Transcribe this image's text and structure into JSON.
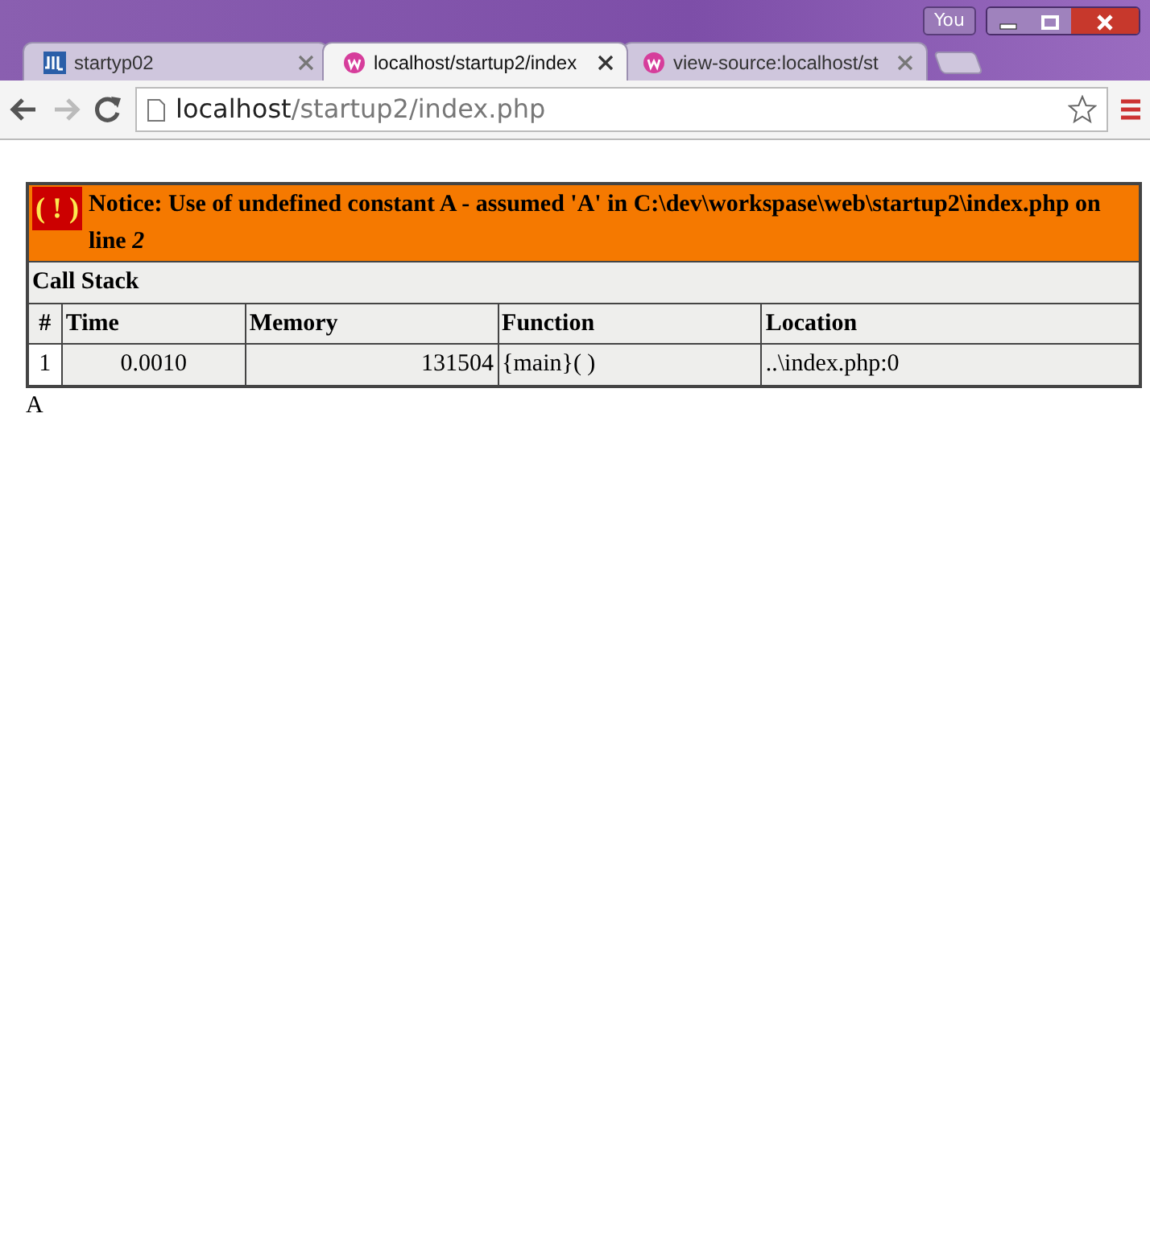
{
  "window": {
    "profile_button": "You"
  },
  "tabs": [
    {
      "label": "startyp02",
      "selected": false
    },
    {
      "label": "localhost/startup2/index",
      "selected": true
    },
    {
      "label": "view-source:localhost/st",
      "selected": false
    }
  ],
  "address_bar": {
    "host": "localhost",
    "path": "/startup2/index.php"
  },
  "error": {
    "badge": "( ! )",
    "message": "Notice: Use of undefined constant A - assumed 'A' in C:\\dev\\workspase\\web\\startup2\\index.php on line *2*",
    "call_stack_title": "Call Stack",
    "columns": [
      "#",
      "Time",
      "Memory",
      "Function",
      "Location"
    ],
    "rows": [
      [
        "1",
        "0.0010",
        "131504",
        "{main}( )",
        "..\\index.php:0"
      ]
    ]
  },
  "output": "A"
}
